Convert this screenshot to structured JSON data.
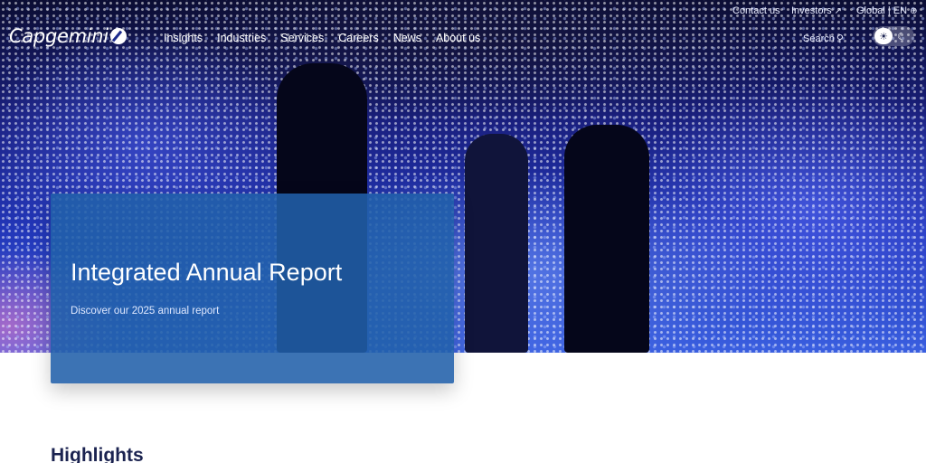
{
  "header": {
    "logo_text": "Capgemini",
    "utility_links": [
      {
        "label": "Contact us"
      },
      {
        "label": "Investors"
      },
      {
        "label": "Global | EN"
      }
    ],
    "nav": [
      "Insights",
      "Industries",
      "Services",
      "Careers",
      "News",
      "About us"
    ],
    "search_label": "Search",
    "theme_toggle": {
      "light": "sun-icon",
      "dark": "moon-icon",
      "selected": "light"
    }
  },
  "hero": {
    "title": "Integrated Annual Report",
    "subtitle": "Discover our 2025 annual report"
  },
  "section": {
    "heading": "Highlights"
  },
  "colors": {
    "card_blue": "#2160aa",
    "heading_navy": "#1b2350",
    "hero_blue": "#2236b8"
  }
}
